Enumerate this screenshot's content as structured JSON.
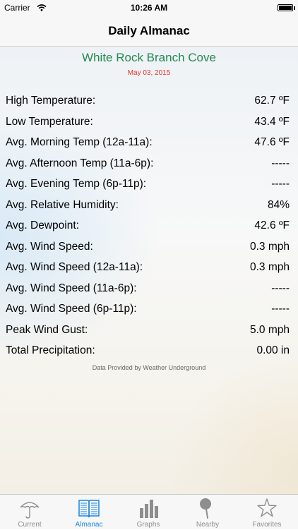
{
  "status_bar": {
    "carrier": "Carrier",
    "time": "10:26 AM"
  },
  "nav": {
    "title": "Daily Almanac"
  },
  "station": {
    "name": "White Rock Branch Cove",
    "date": "May 03, 2015"
  },
  "rows": [
    {
      "label": "High Temperature:",
      "value": "62.7 ºF"
    },
    {
      "label": "Low Temperature:",
      "value": "43.4 ºF"
    },
    {
      "label": "Avg. Morning Temp (12a-11a):",
      "value": "47.6 ºF"
    },
    {
      "label": "Avg. Afternoon Temp (11a-6p):",
      "value": "-----"
    },
    {
      "label": "Avg. Evening Temp (6p-11p):",
      "value": "-----"
    },
    {
      "label": "Avg. Relative Humidity:",
      "value": "84%"
    },
    {
      "label": "Avg. Dewpoint:",
      "value": "42.6 ºF"
    },
    {
      "label": "Avg. Wind Speed:",
      "value": "0.3 mph"
    },
    {
      "label": "Avg. Wind Speed (12a-11a):",
      "value": "0.3 mph"
    },
    {
      "label": "Avg. Wind Speed (11a-6p):",
      "value": "-----"
    },
    {
      "label": "Avg. Wind Speed (6p-11p):",
      "value": "-----"
    },
    {
      "label": "Peak Wind Gust:",
      "value": "5.0 mph"
    },
    {
      "label": "Total Precipitation:",
      "value": "0.00 in"
    }
  ],
  "credit": "Data Provided by Weather Underground",
  "tabs": [
    {
      "label": "Current",
      "icon": "umbrella-icon"
    },
    {
      "label": "Almanac",
      "icon": "book-icon"
    },
    {
      "label": "Graphs",
      "icon": "bar-graph-icon"
    },
    {
      "label": "Nearby",
      "icon": "pin-icon"
    },
    {
      "label": "Favorites",
      "icon": "star-icon"
    }
  ],
  "active_tab": "Almanac",
  "colors": {
    "station": "#228a4e",
    "date": "#e0362b",
    "active_tab": "#1a86e0",
    "inactive_tab": "#8e8e8e"
  }
}
